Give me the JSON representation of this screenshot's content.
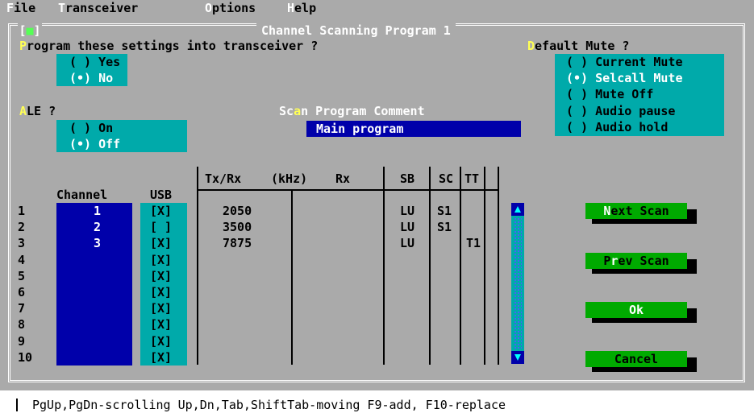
{
  "menu": {
    "file_hk": "F",
    "file_rest": "ile",
    "transceiver_hk": "T",
    "transceiver_rest": "ransceiver",
    "options_hk": "O",
    "options_rest": "ptions",
    "help_hk": "H",
    "help_rest": "elp"
  },
  "dialog": {
    "title": "Channel Scanning Program 1",
    "close_box": "■"
  },
  "program_group": {
    "label_hk": "P",
    "label_rest": "rogram these settings into transceiver ?",
    "options": [
      {
        "marker": "( )",
        "text": "Yes",
        "selected": false
      },
      {
        "marker": "(•)",
        "text": "No",
        "selected": true
      }
    ]
  },
  "ale_group": {
    "label_hk": "A",
    "label_rest": "LE ?",
    "options": [
      {
        "marker": "( )",
        "text": "On",
        "selected": false
      },
      {
        "marker": "(•)",
        "text": "Off",
        "selected": true
      }
    ]
  },
  "comment": {
    "label_pre": "Sc",
    "label_hk": "a",
    "label_rest": "n Program Comment",
    "value": "Main program"
  },
  "mute_group": {
    "label_hk": "D",
    "label_rest": "efault Mute ?",
    "options": [
      {
        "marker": "( )",
        "text": "Current Mute",
        "selected": false
      },
      {
        "marker": "(•)",
        "text": "Selcall Mute",
        "selected": true
      },
      {
        "marker": "( )",
        "text": "Mute Off",
        "selected": false
      },
      {
        "marker": "( )",
        "text": "Audio pause",
        "selected": false
      },
      {
        "marker": "( )",
        "text": "Audio hold",
        "selected": false
      }
    ]
  },
  "table": {
    "headers": {
      "channel": "Channel",
      "usb": "USB",
      "txrx": "Tx/Rx",
      "khz": "(kHz)",
      "rx": "Rx",
      "sb": "SB",
      "sc": "SC",
      "tt": "TT"
    },
    "rows": [
      {
        "num": "1",
        "channel": "1",
        "usb": "[X]",
        "txrx": "2050",
        "rx": "",
        "sb": "LU",
        "sc": "S1",
        "tt": ""
      },
      {
        "num": "2",
        "channel": "2",
        "usb": "[ ]",
        "txrx": "3500",
        "rx": "",
        "sb": "LU",
        "sc": "S1",
        "tt": ""
      },
      {
        "num": "3",
        "channel": "3",
        "usb": "[X]",
        "txrx": "7875",
        "rx": "",
        "sb": "LU",
        "sc": "",
        "tt": "T1"
      },
      {
        "num": "4",
        "channel": "",
        "usb": "[X]",
        "txrx": "",
        "rx": "",
        "sb": "",
        "sc": "",
        "tt": ""
      },
      {
        "num": "5",
        "channel": "",
        "usb": "[X]",
        "txrx": "",
        "rx": "",
        "sb": "",
        "sc": "",
        "tt": ""
      },
      {
        "num": "6",
        "channel": "",
        "usb": "[X]",
        "txrx": "",
        "rx": "",
        "sb": "",
        "sc": "",
        "tt": ""
      },
      {
        "num": "7",
        "channel": "",
        "usb": "[X]",
        "txrx": "",
        "rx": "",
        "sb": "",
        "sc": "",
        "tt": ""
      },
      {
        "num": "8",
        "channel": "",
        "usb": "[X]",
        "txrx": "",
        "rx": "",
        "sb": "",
        "sc": "",
        "tt": ""
      },
      {
        "num": "9",
        "channel": "",
        "usb": "[X]",
        "txrx": "",
        "rx": "",
        "sb": "",
        "sc": "",
        "tt": ""
      },
      {
        "num": "10",
        "channel": "",
        "usb": "[X]",
        "txrx": "",
        "rx": "",
        "sb": "",
        "sc": "",
        "tt": ""
      }
    ]
  },
  "buttons": {
    "next": {
      "hk": "N",
      "rest": "ext Scan"
    },
    "prev": {
      "pre": "P",
      "hk": "r",
      "rest": "ev Scan"
    },
    "ok": {
      "label": "Ok"
    },
    "cancel": {
      "label": "Cancel"
    }
  },
  "statusbar": {
    "text": "PgUp,PgDn-scrolling Up,Dn,Tab,ShiftTab-moving F9-add, F10-replace"
  },
  "colors": {
    "dialog_bg": "#aaaaaa",
    "teal": "#00aaaa",
    "blue": "#0000aa",
    "button_green": "#00aa00",
    "hotkey_yellow": "#ffff55"
  }
}
